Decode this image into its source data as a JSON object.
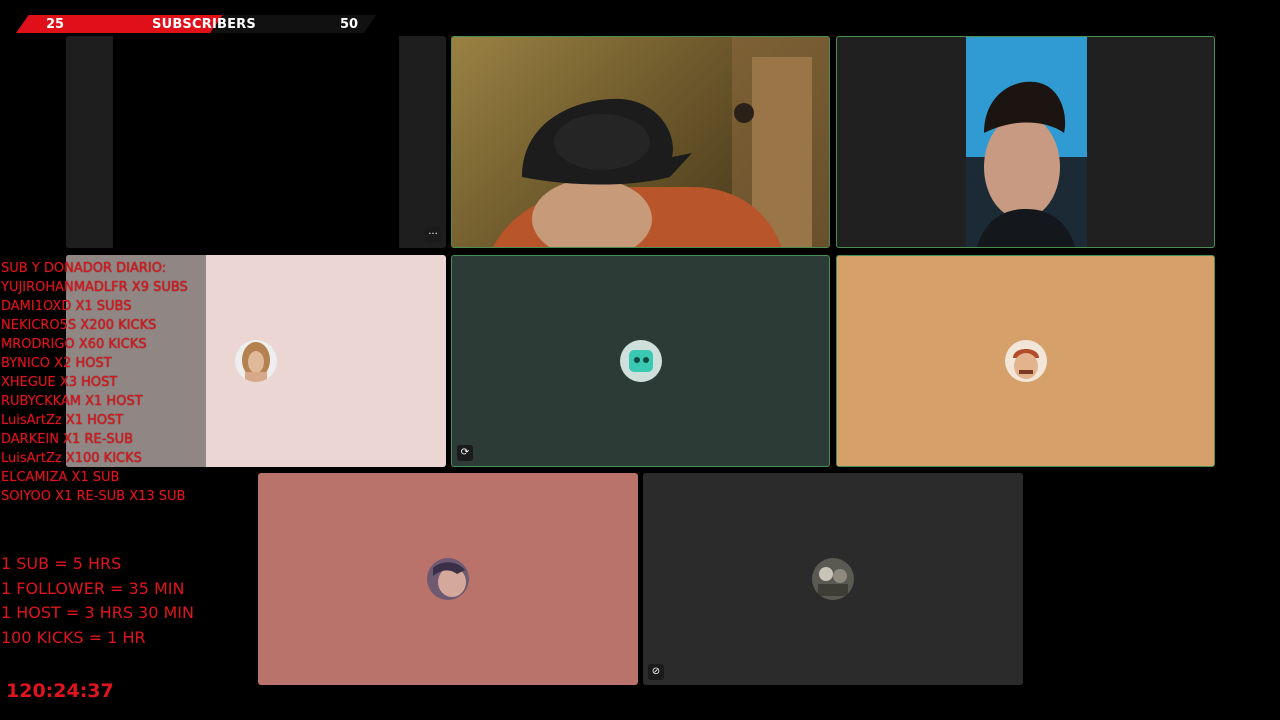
{
  "sub_goal": {
    "current": "25",
    "label": "SUBSCRIBERS",
    "goal": "50",
    "progress_fraction": 0.5,
    "bar_color": "#e0101a"
  },
  "tiles": [
    {
      "name": "tile-camera-off",
      "bg": "#000000",
      "menu_icon": "more-icon",
      "menu_glyph": "···"
    },
    {
      "name": "tile-webcam-cap",
      "bg": "#6d5a2a"
    },
    {
      "name": "tile-phone-cam",
      "bg": "#202020"
    },
    {
      "name": "tile-avatar-long-hair",
      "bg": "#ecd6d4"
    },
    {
      "name": "tile-avatar-teal-bot",
      "bg": "#2c3b35",
      "status_icon": "refresh-icon",
      "status_glyph": "⟳"
    },
    {
      "name": "tile-avatar-cartoon",
      "bg": "#d5a06a"
    },
    {
      "name": "tile-avatar-face",
      "bg": "#b9736a"
    },
    {
      "name": "tile-avatar-group",
      "bg": "#2b2b2b",
      "status_icon": "muted-mic-icon",
      "status_glyph": "⊘"
    }
  ],
  "donors": {
    "title": "SUB Y DONADOR DIARIO:",
    "entries": [
      "YUJIROHANMADLFR X9 SUBS",
      "DAMI1OXD X1 SUBS",
      "NEKICRO5S X200 KICKS",
      "MRODRIGO X60 KICKS",
      "BYNICO X2 HOST",
      "XHEGUE X3 HOST",
      "RUBYCKKAM X1 HOST",
      "LuisArtZz X1 HOST",
      "DARKEIN X1 RE-SUB",
      "LuisArtZz X100 KICKS",
      "ELCAMIZA X1 SUB",
      "SOIYOO X1 RE-SUB X13 SUB"
    ]
  },
  "rules": [
    "1 SUB = 5 HRS",
    "1 FOLLOWER = 35 MIN",
    "1 HOST = 3 HRS 30 MIN",
    "100 KICKS = 1 HR"
  ],
  "timer": "120:24:37",
  "accent_color": "#e0141c"
}
